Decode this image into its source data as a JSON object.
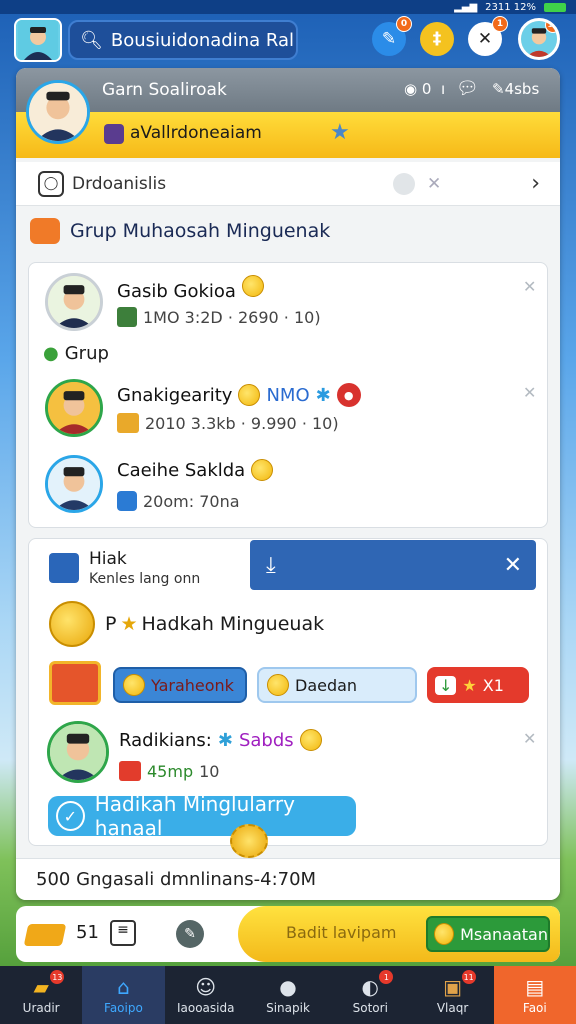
{
  "status_bar": {
    "time": "2311 12%"
  },
  "search": {
    "text": "Bousiuidonadina Ral"
  },
  "top_badges": {
    "messages": "0",
    "notifications": "1",
    "profile": "12"
  },
  "profile": {
    "name": "Garn Soaliroak",
    "stats": [
      "0  ı",
      " ",
      "4sbs"
    ],
    "subtitle": "aVallrdoneaiam"
  },
  "info_row": {
    "label": "Drdoanislis"
  },
  "group": {
    "title": "Grup Muhaosah Minguenak",
    "subheading": "Grup"
  },
  "members": [
    {
      "name": "Gasib Gokioa",
      "stats": "1MO 3:2D · 2690 · 10)"
    },
    {
      "name": "Gnakigearity",
      "tag": "NMO",
      "stats": "2010 3.3kb · 9.990 · 10)"
    },
    {
      "name": "Caeihe Saklda",
      "stats": "20om: 70na"
    }
  ],
  "reward": {
    "badge_title": "Hiak",
    "badge_sub": "Kenles lang onn",
    "heading": "Hadkah Mingueuak",
    "heading_prefix": "P",
    "pills": [
      "Yaraheonk",
      "Daedan",
      "X1"
    ],
    "winner_name": "Radikians:",
    "winner_tag": "Sabds",
    "winner_stats": [
      "45mp",
      "10"
    ],
    "cta": "Hadikah Minglularry hanaal"
  },
  "footer": {
    "text": "500 Gngasali dmnlinans-4:70M"
  },
  "action_bar": {
    "count": "51",
    "label": "Badit lavipam",
    "button": "Msanaatan"
  },
  "nav": [
    {
      "label": "Uradir",
      "icon": "badge-icon",
      "badge": "13"
    },
    {
      "label": "Faoipo",
      "icon": "home-icon",
      "active": true
    },
    {
      "label": "Iaooasida",
      "icon": "person-icon"
    },
    {
      "label": "Sinapik",
      "icon": "chat-icon"
    },
    {
      "label": "Sotori",
      "icon": "tag-icon",
      "badge": "1"
    },
    {
      "label": "Vlaqr",
      "icon": "card-icon",
      "badge": "11"
    },
    {
      "label": "Faoi",
      "icon": "store-icon",
      "highlight": true
    }
  ],
  "colors": {
    "accent_blue": "#2f66b4",
    "yellow": "#f6b918",
    "green": "#2c9a3a",
    "orange": "#f0662c"
  }
}
